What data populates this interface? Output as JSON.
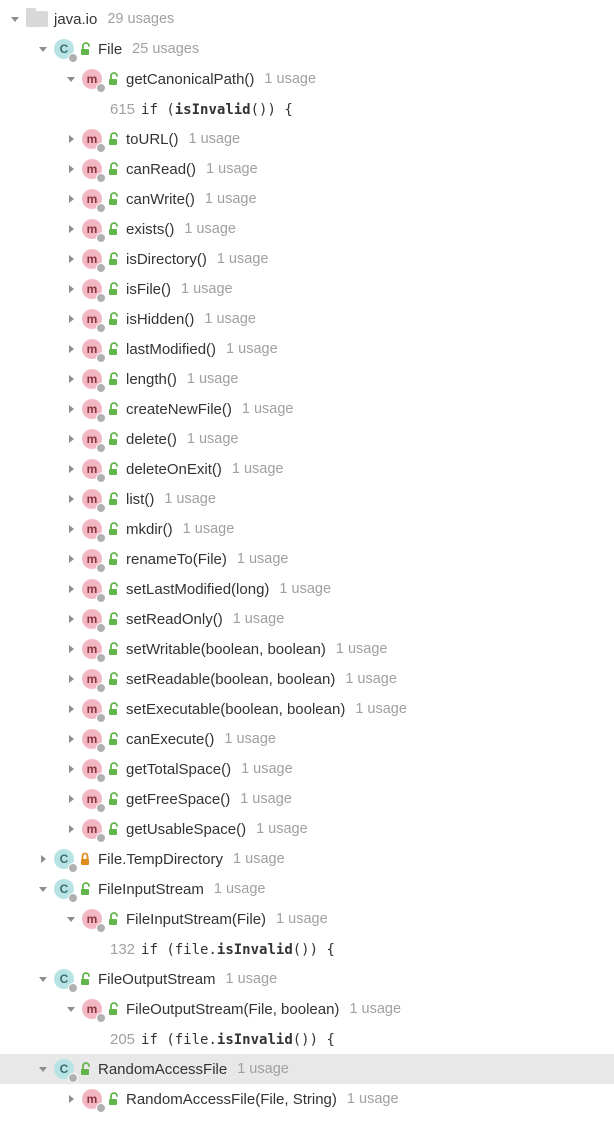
{
  "root": {
    "name": "java.io",
    "usages": "29 usages"
  },
  "fileClass": {
    "name": "File",
    "usages": "25 usages",
    "methods": [
      {
        "key": "getCanonicalPath",
        "name": "getCanonicalPath()",
        "usages": "1 usage",
        "expanded": true,
        "code": {
          "ln": "615",
          "pre": "if (",
          "bold": "isInvalid",
          "post": "()) {"
        }
      },
      {
        "key": "toURL",
        "name": "toURL()",
        "usages": "1 usage"
      },
      {
        "key": "canRead",
        "name": "canRead()",
        "usages": "1 usage"
      },
      {
        "key": "canWrite",
        "name": "canWrite()",
        "usages": "1 usage"
      },
      {
        "key": "exists",
        "name": "exists()",
        "usages": "1 usage"
      },
      {
        "key": "isDirectory",
        "name": "isDirectory()",
        "usages": "1 usage"
      },
      {
        "key": "isFile",
        "name": "isFile()",
        "usages": "1 usage"
      },
      {
        "key": "isHidden",
        "name": "isHidden()",
        "usages": "1 usage"
      },
      {
        "key": "lastModified",
        "name": "lastModified()",
        "usages": "1 usage"
      },
      {
        "key": "length",
        "name": "length()",
        "usages": "1 usage"
      },
      {
        "key": "createNewFile",
        "name": "createNewFile()",
        "usages": "1 usage"
      },
      {
        "key": "delete",
        "name": "delete()",
        "usages": "1 usage"
      },
      {
        "key": "deleteOnExit",
        "name": "deleteOnExit()",
        "usages": "1 usage"
      },
      {
        "key": "list",
        "name": "list()",
        "usages": "1 usage"
      },
      {
        "key": "mkdir",
        "name": "mkdir()",
        "usages": "1 usage"
      },
      {
        "key": "renameTo",
        "name": "renameTo(File)",
        "usages": "1 usage"
      },
      {
        "key": "setLastModified",
        "name": "setLastModified(long)",
        "usages": "1 usage"
      },
      {
        "key": "setReadOnly",
        "name": "setReadOnly()",
        "usages": "1 usage"
      },
      {
        "key": "setWritable",
        "name": "setWritable(boolean, boolean)",
        "usages": "1 usage"
      },
      {
        "key": "setReadable",
        "name": "setReadable(boolean, boolean)",
        "usages": "1 usage"
      },
      {
        "key": "setExecutable",
        "name": "setExecutable(boolean, boolean)",
        "usages": "1 usage"
      },
      {
        "key": "canExecute",
        "name": "canExecute()",
        "usages": "1 usage"
      },
      {
        "key": "getTotalSpace",
        "name": "getTotalSpace()",
        "usages": "1 usage"
      },
      {
        "key": "getFreeSpace",
        "name": "getFreeSpace()",
        "usages": "1 usage"
      },
      {
        "key": "getUsableSpace",
        "name": "getUsableSpace()",
        "usages": "1 usage"
      }
    ]
  },
  "tempDirectory": {
    "name": "File.TempDirectory",
    "usages": "1 usage"
  },
  "fileInputStream": {
    "name": "FileInputStream",
    "usages": "1 usage",
    "ctor": {
      "name": "FileInputStream(File)",
      "usages": "1 usage",
      "code": {
        "ln": "132",
        "pre": "if (file.",
        "bold": "isInvalid",
        "post": "()) {"
      }
    }
  },
  "fileOutputStream": {
    "name": "FileOutputStream",
    "usages": "1 usage",
    "ctor": {
      "name": "FileOutputStream(File, boolean)",
      "usages": "1 usage",
      "code": {
        "ln": "205",
        "pre": "if (file.",
        "bold": "isInvalid",
        "post": "()) {"
      }
    }
  },
  "randomAccessFile": {
    "name": "RandomAccessFile",
    "usages": "1 usage",
    "ctor": {
      "name": "RandomAccessFile(File, String)",
      "usages": "1 usage"
    }
  }
}
